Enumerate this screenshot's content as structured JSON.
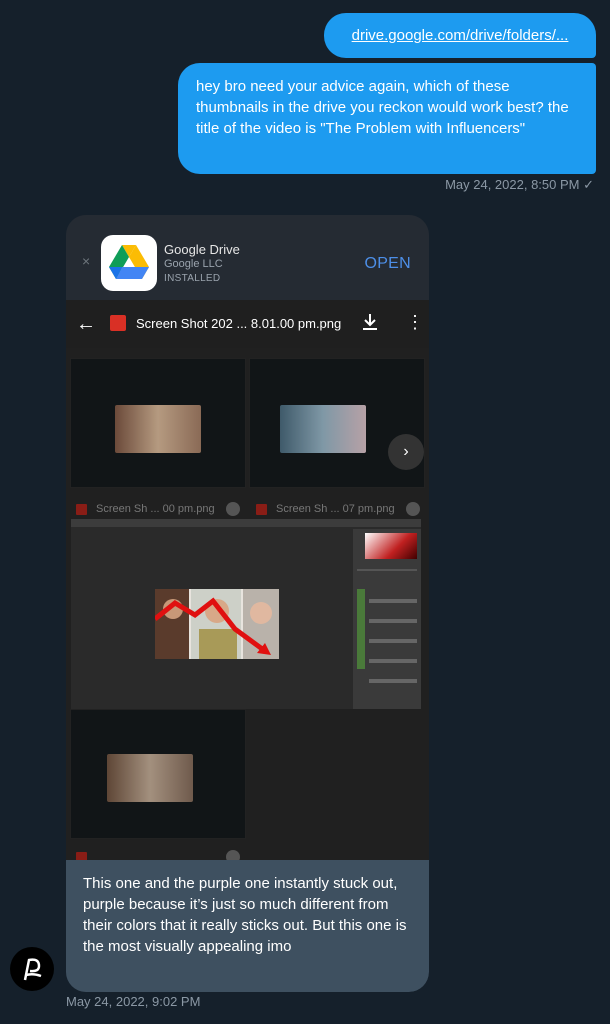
{
  "messages": {
    "outgoing_link": "drive.google.com/drive/folders/...",
    "outgoing_text": "hey bro need your advice again, which of these thumbnails in the drive you reckon would work best? the title of the video is \"The Problem with Influencers\"",
    "outgoing_time": "May 24, 2022, 8:50 PM ✓",
    "incoming_text": "This one and the purple one instantly stuck out, purple because it’s just so much different from their colors that it really sticks out. But this one is the most visually appealing imo",
    "incoming_time": "May 24, 2022, 9:02 PM"
  },
  "app_banner": {
    "close": "×",
    "name": "Google Drive",
    "developer": "Google LLC",
    "status": "INSTALLED",
    "open_label": "OPEN"
  },
  "viewer": {
    "back": "←",
    "file_name": "Screen Shot 202 ... 8.01.00 pm.png",
    "more": "⋮",
    "next": "›"
  },
  "tiles": {
    "tile1_label": "Screen Sh ... 00 pm.png",
    "tile2_label": "Screen Sh ... 07 pm.png"
  },
  "colors": {
    "background": "#15202b",
    "outgoing_bubble": "#1d9bf0",
    "incoming_bubble": "#3e5060",
    "open_link": "#4d8fe8"
  }
}
